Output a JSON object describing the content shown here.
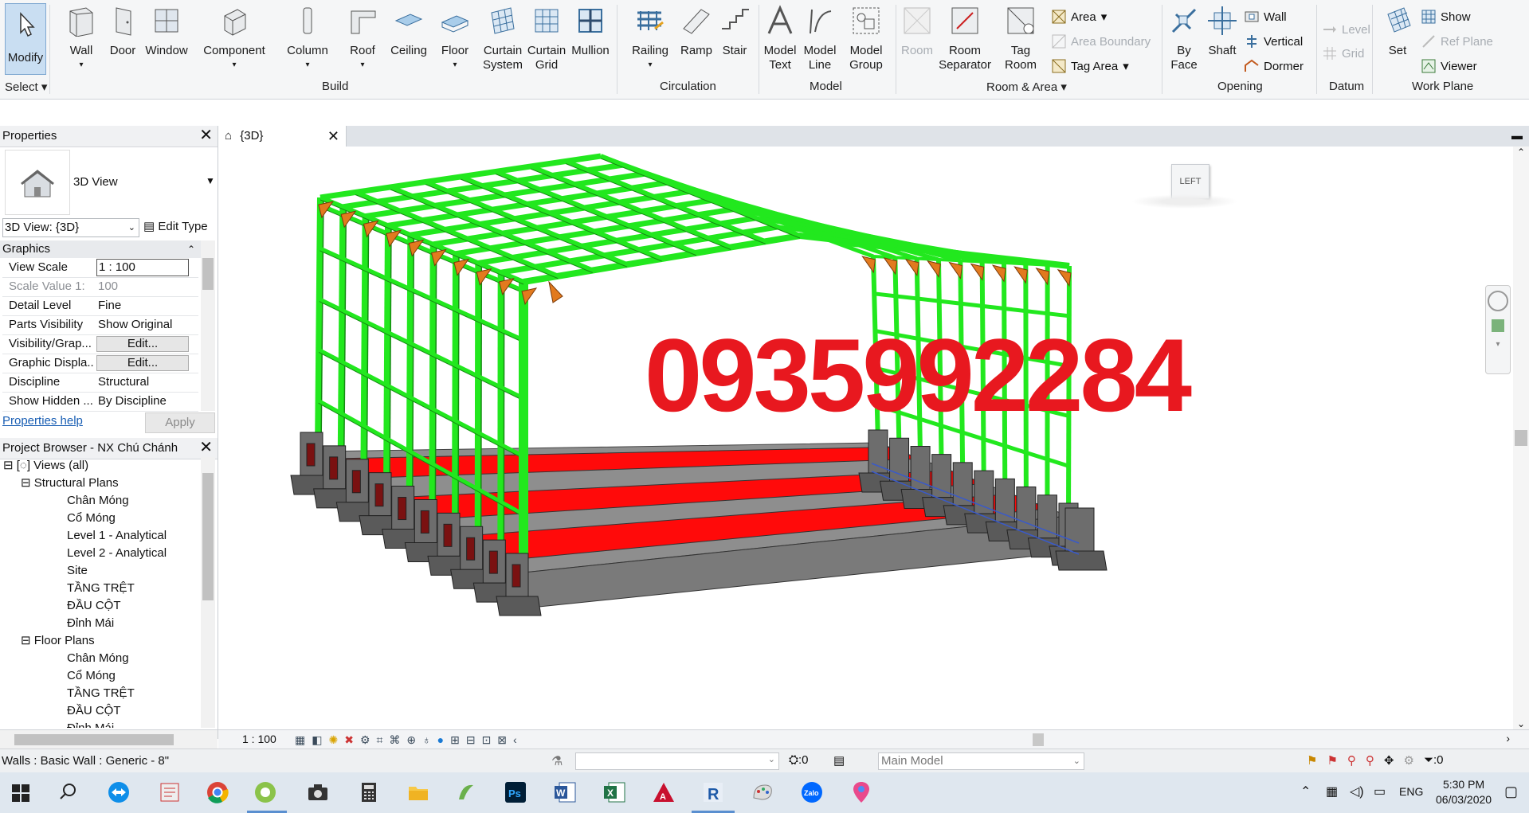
{
  "ribbon": {
    "select": {
      "modify": "Modify",
      "select_label": "Select"
    },
    "build": {
      "label": "Build",
      "wall": "Wall",
      "door": "Door",
      "window": "Window",
      "component": "Component",
      "column": "Column",
      "roof": "Roof",
      "ceiling": "Ceiling",
      "floor": "Floor",
      "curtain_system_1": "Curtain",
      "curtain_system_2": "System",
      "curtain_grid_1": "Curtain",
      "curtain_grid_2": "Grid",
      "mullion": "Mullion"
    },
    "circulation": {
      "label": "Circulation",
      "railing": "Railing",
      "ramp": "Ramp",
      "stair": "Stair"
    },
    "model": {
      "label": "Model",
      "model_text_1": "Model",
      "model_text_2": "Text",
      "model_line_1": "Model",
      "model_line_2": "Line",
      "model_group_1": "Model",
      "model_group_2": "Group"
    },
    "room_area": {
      "label": "Room & Area",
      "room": "Room",
      "room_sep_1": "Room",
      "room_sep_2": "Separator",
      "tag_room_1": "Tag",
      "tag_room_2": "Room",
      "area": "Area",
      "area_boundary": "Area  Boundary",
      "tag_area": "Tag  Area"
    },
    "opening": {
      "label": "Opening",
      "by_face_1": "By",
      "by_face_2": "Face",
      "shaft": "Shaft",
      "wall": "Wall",
      "vertical": "Vertical",
      "dormer": "Dormer"
    },
    "datum": {
      "label": "Datum",
      "level": "Level",
      "grid": "Grid"
    },
    "work_plane": {
      "label": "Work Plane",
      "set": "Set",
      "show": "Show",
      "ref_plane": "Ref  Plane",
      "viewer": "Viewer"
    }
  },
  "properties": {
    "title": "Properties",
    "type_name": "3D View",
    "selector": "3D View: {3D}",
    "edit_type": "Edit Type",
    "section": "Graphics",
    "rows": [
      {
        "key": "View Scale",
        "value": "1 : 100"
      },
      {
        "key": "Scale Value    1:",
        "value": "100"
      },
      {
        "key": "Detail Level",
        "value": "Fine"
      },
      {
        "key": "Parts Visibility",
        "value": "Show Original"
      },
      {
        "key": "Visibility/Grap...",
        "value": "Edit..."
      },
      {
        "key": "Graphic Displa...",
        "value": "Edit..."
      },
      {
        "key": "Discipline",
        "value": "Structural"
      },
      {
        "key": "Show Hidden ...",
        "value": "By Discipline"
      }
    ],
    "help": "Properties help",
    "apply": "Apply"
  },
  "browser": {
    "title": "Project Browser - NX Chú Chánh",
    "root": "Views (all)",
    "groups": [
      {
        "name": "Structural Plans",
        "items": [
          "Chân Móng",
          "Cổ Móng",
          "Level 1 - Analytical",
          "Level 2 - Analytical",
          "Site",
          "TẦNG TRỆT",
          "ĐẦU CỘT",
          "Đỉnh Mái"
        ]
      },
      {
        "name": "Floor Plans",
        "items": [
          "Chân Móng",
          "Cổ Móng",
          "TẦNG TRỆT",
          "ĐẦU CỘT",
          "Đỉnh Mái"
        ]
      }
    ]
  },
  "view": {
    "tab": "{3D}",
    "watermark": "0935992284",
    "viewcube": "LEFT",
    "scale": "1 : 100"
  },
  "status": {
    "left": "Walls : Basic Wall : Generic - 8\"",
    "filter_count": ":0",
    "model": "Main Model",
    "sel_count": ":0"
  },
  "taskbar": {
    "lang": "ENG",
    "time": "5:30 PM",
    "date": "06/03/2020"
  },
  "colors": {
    "steel": "#22e81e",
    "floor": "#ff0a0a",
    "concrete": "#6d6d6d",
    "watermark": "#e8181f",
    "brace": "#e27a1e"
  }
}
